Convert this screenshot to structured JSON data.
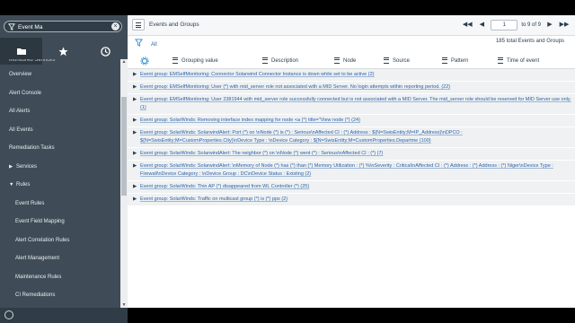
{
  "sidebar": {
    "filter_value": "Event Ma",
    "clear_label": "×",
    "cut_item": "Monitored Services",
    "items": [
      {
        "label": "Overview",
        "caret": ""
      },
      {
        "label": "Alert Console",
        "caret": ""
      },
      {
        "label": "All Alerts",
        "caret": ""
      },
      {
        "label": "All Events",
        "caret": ""
      },
      {
        "label": "Remediation Tasks",
        "caret": ""
      },
      {
        "label": "Services",
        "caret": "▶"
      },
      {
        "label": "Rules",
        "caret": "▼"
      },
      {
        "label": "Event Rules",
        "caret": ""
      },
      {
        "label": "Event Field Mapping",
        "caret": ""
      },
      {
        "label": "Alert Correlation Rules",
        "caret": ""
      },
      {
        "label": "Alert Management",
        "caret": ""
      },
      {
        "label": "Maintenance Rules",
        "caret": ""
      },
      {
        "label": "CI Remediations",
        "caret": ""
      }
    ]
  },
  "header": {
    "title": "Events and Groups",
    "page_input": "1",
    "page_of": "to 9 of 9"
  },
  "filter": {
    "all_label": "All",
    "count_text": "185  total Events and Groups"
  },
  "columns": [
    "Grouping value",
    "Description",
    "Node",
    "Source",
    "Pattern",
    "Time of event"
  ],
  "groups": [
    "Event group: EMSelfMonitoring: Connector Solarwind Connector Instance is down while set to be active (2)",
    "Event group: EMSelfMonitoring: User (*) with mid_server role not associated with a MID Server. No login attempts within reporting period. (22)",
    "Event group: EMSelfMonitoring: User 2381944 with mid_server role successfully connected but is not associated with a MID Server. The mid_server role should be reserved for MID Server use only. (1)",
    "Event group: SolarWinds: Removing interface index mapping for node <a (*) title=\"View node (*) (24)",
    "Event group: SolarWinds: SolarwindAlert: Port (*) on \\nNode (*) is (*) : Serious\\nAffected CI : (*) Address : ${N=SwisEntity;M=IP_Address}\\nDPCO : ${N=SwisEntity;M=CustomProperties.City}\\nDevice Type : \\nDevice Category : ${N=SwisEntity;M=CustomProperties.Departme (100)",
    "Event group: SolarWinds: SolarwindAlert: The neighbor (*) on \\nNode (*) went (*) : Serious\\nAffected CI : (*) (7)",
    "Event group: SolarWinds: SolarwindAlert: \\nMemory of Node (*) has (*) than (*) Memory Utilization : (*) %\\nSeverity : Critical\\nAffected CI : (*) Address : (*) Address : (*) Niger\\nDevice Type : Firewall\\nDevice Category : \\nDevice Group : DC\\nDevice Status : Existing (2)",
    "Event group: SolarWinds: Thin AP (*) disappeared from WL Controller (*) (25)",
    "Event group: SolarWinds: Traffic on multicast group (*) is (*) pps (2)"
  ],
  "icons": {
    "filter": "funnel-icon",
    "favorites": "star-icon",
    "history": "clock-icon"
  },
  "colors": {
    "sidebar": "#3f4c57",
    "link": "#2a62a8",
    "accent": "#2a8ad0"
  }
}
